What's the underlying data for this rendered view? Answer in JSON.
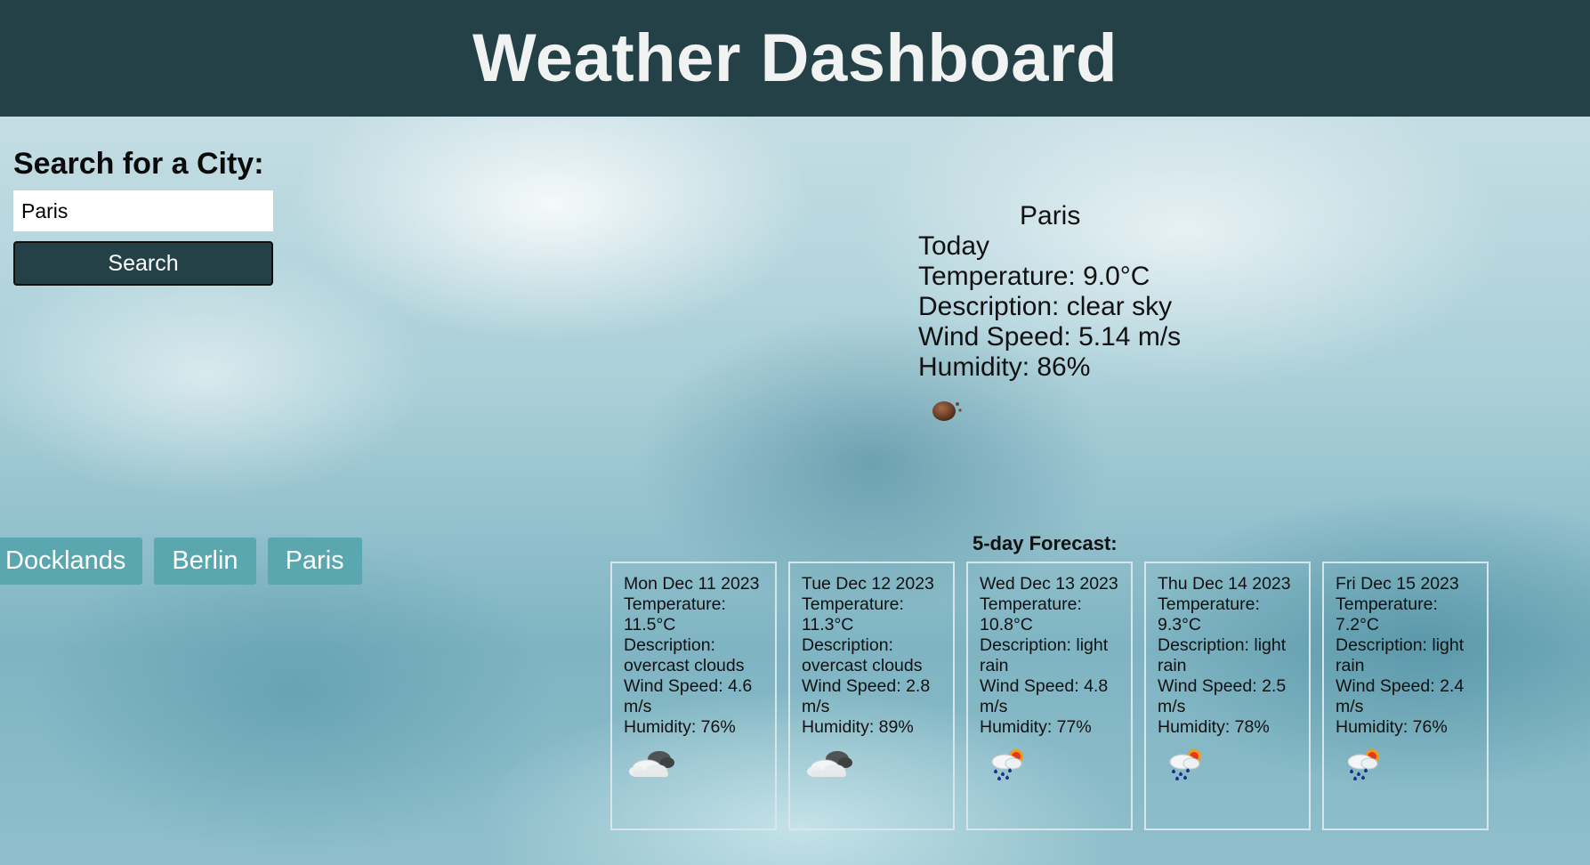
{
  "header": {
    "title": "Weather Dashboard"
  },
  "search": {
    "heading": "Search for a City:",
    "input_value": "Paris",
    "button_label": "Search"
  },
  "history": [
    "Docklands",
    "Berlin",
    "Paris"
  ],
  "current": {
    "city": "Paris",
    "day": "Today",
    "temperature": "Temperature: 9.0°C",
    "description": "Description: clear sky",
    "wind": "Wind Speed: 5.14 m/s",
    "humidity": "Humidity: 86%",
    "icon": "moon-icon"
  },
  "forecast": {
    "title": "5-day Forecast:",
    "days": [
      {
        "date": "Mon Dec 11 2023",
        "temperature": "Temperature: 11.5°C",
        "description": "Description: overcast clouds",
        "wind": "Wind Speed: 4.6 m/s",
        "humidity": "Humidity: 76%",
        "icon": "overcast-clouds-icon"
      },
      {
        "date": "Tue Dec 12 2023",
        "temperature": "Temperature: 11.3°C",
        "description": "Description: overcast clouds",
        "wind": "Wind Speed: 2.8 m/s",
        "humidity": "Humidity: 89%",
        "icon": "overcast-clouds-icon"
      },
      {
        "date": "Wed Dec 13 2023",
        "temperature": "Temperature: 10.8°C",
        "description": "Description: light rain",
        "wind": "Wind Speed: 4.8 m/s",
        "humidity": "Humidity: 77%",
        "icon": "light-rain-icon"
      },
      {
        "date": "Thu Dec 14 2023",
        "temperature": "Temperature: 9.3°C",
        "description": "Description: light rain",
        "wind": "Wind Speed: 2.5 m/s",
        "humidity": "Humidity: 78%",
        "icon": "light-rain-icon"
      },
      {
        "date": "Fri Dec 15 2023",
        "temperature": "Temperature: 7.2°C",
        "description": "Description: light rain",
        "wind": "Wind Speed: 2.4 m/s",
        "humidity": "Humidity: 76%",
        "icon": "light-rain-icon"
      }
    ]
  }
}
